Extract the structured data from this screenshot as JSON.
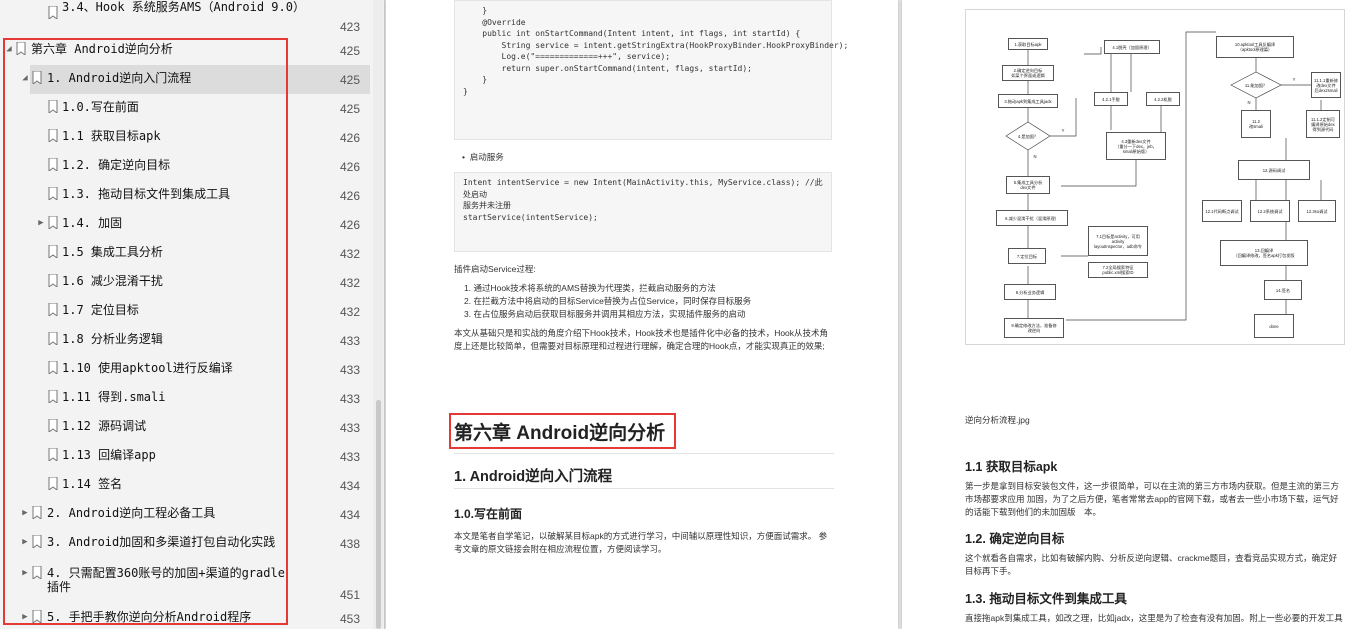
{
  "sidebar": {
    "items": [
      {
        "label": "3.4、Hook 系统服务AMS（Android 9.0）",
        "page": "423"
      },
      {
        "label": "第六章 Android逆向分析",
        "page": "425"
      },
      {
        "label": "1. Android逆向入门流程",
        "page": "425"
      },
      {
        "label": "1.0.写在前面",
        "page": "425"
      },
      {
        "label": "1.1 获取目标apk",
        "page": "426"
      },
      {
        "label": "1.2. 确定逆向目标",
        "page": "426"
      },
      {
        "label": "1.3. 拖动目标文件到集成工具",
        "page": "426"
      },
      {
        "label": "1.4. 加固",
        "page": "426"
      },
      {
        "label": "1.5 集成工具分析",
        "page": "432"
      },
      {
        "label": "1.6 减少混淆干扰",
        "page": "432"
      },
      {
        "label": "1.7 定位目标",
        "page": "432"
      },
      {
        "label": "1.8 分析业务逻辑",
        "page": "433"
      },
      {
        "label": "1.10 使用apktool进行反编译",
        "page": "433"
      },
      {
        "label": "1.11 得到.smali",
        "page": "433"
      },
      {
        "label": "1.12 源码调试",
        "page": "433"
      },
      {
        "label": "1.13 回编译app",
        "page": "433"
      },
      {
        "label": "1.14 签名",
        "page": "434"
      },
      {
        "label": "2. Android逆向工程必备工具",
        "page": "434"
      },
      {
        "label": "3. Android加固和多渠道打包自动化实践",
        "page": "438"
      },
      {
        "label": "4. 只需配置360账号的加固+渠道的gradle插件",
        "page": "451"
      },
      {
        "label": "5. 手把手教你逆向分析Android程序",
        "page": "453"
      }
    ]
  },
  "page_left": {
    "code1": "    }\n    @Override\n    public int onStartCommand(Intent intent, int flags, int startId) {\n        String service = intent.getStringExtra(HookProxyBinder.HookProxyBinder);\n        Log.e(\"=============+++\", service);\n        return super.onStartCommand(intent, flags, startId);\n    }\n}",
    "bullet": "启动服务",
    "code2": "Intent intentService = new Intent(MainActivity.this, MyService.class); //此处启动\n服务并未注册\nstartService(intentService);",
    "process_title": "插件启动Service过程:",
    "steps": [
      "1. 通过Hook技术将系统的AMS替换为代理类，拦截启动服务的方法",
      "2. 在拦截方法中将启动的目标Service替换为占位Service，同时保存目标服务",
      "3. 在占位服务启动后获取目标服务并调用其相应方法，实现插件服务的启动"
    ],
    "para1": "本文从基础只是和实战的角度介绍下Hook技术，Hook技术也是插件化中必备的技术，Hook从技术角度上还是比较简单，但需要对目标原理和过程进行理解，确定合理的Hook点，才能实现真正的效果;",
    "chapter_title": "第六章 Android逆向分析",
    "section_title": "1. Android逆向入门流程",
    "sub_title": "1.0.写在前面",
    "para2": "本文是笔者自学笔记，以破解某目标apk的方式进行学习，中间辅以原理性知识，方便面试需求。 参考文章的原文链接会附在相应流程位置，方便阅读学习。"
  },
  "page_right": {
    "flow": {
      "n1": "1.获取目标apk",
      "n2": "2.确定逆向目标\n如某个界面或逻辑",
      "n3": "3.拖动apk到集成工具jadx",
      "n4": "4.是加固？",
      "n5": "5.集成工具分析\ndex文件",
      "n6": "6.减少混淆干扰（混淆原理）",
      "n7": "7.定位目标",
      "n71": "7.1目标是activity，可用\nactivity\nlayoutInspector，adb命令",
      "n72": "7.2全局搜索特征\npublic.xml搜索ID",
      "n8": "8.分析业务逻辑",
      "n9": "9.确定修改方法，准备修\n改逆向",
      "n41": "4.1脱壳（加固原理）",
      "n421": "4.2.1手脱",
      "n422": "4.2.2机脱",
      "n43": "4.3重新dex文件\n（重分一下dex，jeb，\nsmali原始版）",
      "n10": "10.apktool工具反编译\n（apktool原理篇）",
      "n11": "11.能加固？",
      "n111": "11.1.1重新修\n改dex文件\n后dex2smali",
      "n112": "11.2\n改smali",
      "n1112": "11.1.2定制可\n编译原始dex\n得到源代码",
      "n12": "12.源码调试",
      "n121": "12.1代码断点调试",
      "n122": "12.2系统调试",
      "n123": "12.3so调试",
      "n13": "13.回编译\n（回编译修改，签名apk打包发版",
      "n14": "14.签名",
      "done": "done",
      "y": "Y",
      "n": "N"
    },
    "caption": "逆向分析流程.jpg",
    "h11": "1.1 获取目标apk",
    "p11": "第一步是拿到目标安装包文件，这一步很简单，可以在主流的第三方市场内获取。但是主流的第三方市场都要求应用 加固，为了之后方便，笔者常常去app的官网下载，或者去一些小市场下载，运气好的话能下载到他们的未加固版　本。",
    "h12": "1.2. 确定逆向目标",
    "p12": "这个就看各自需求，比如有破解内购、分析反逆向逻辑、crackme题目，查看竞品实现方式，确定好目标再下手。",
    "h13": "1.3. 拖动目标文件到集成工具",
    "p13": "直接拖apk到集成工具，如改之理，比如jadx，这里是为了检查有没有加固。附上一些必要的开发工具"
  }
}
